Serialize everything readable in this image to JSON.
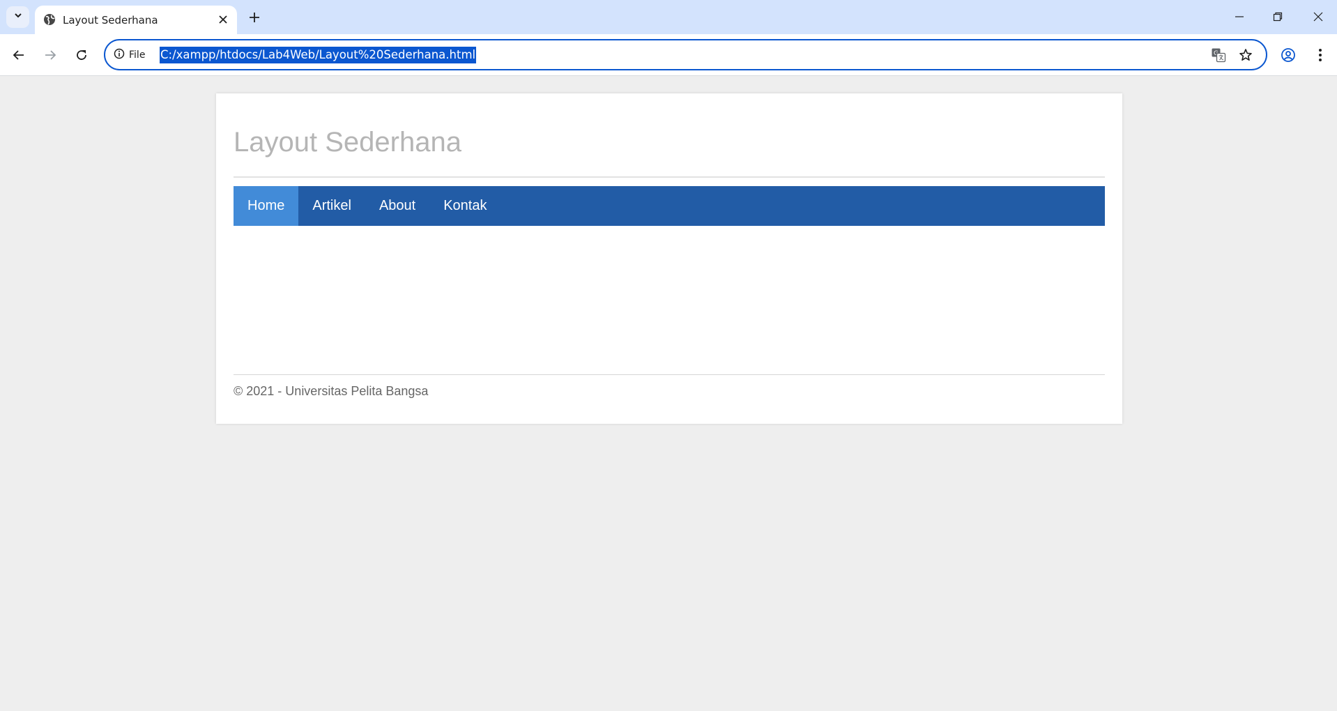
{
  "browser": {
    "tab": {
      "title": "Layout Sederhana"
    },
    "address_bar": {
      "scheme_label": "File",
      "url": "C:/xampp/htdocs/Lab4Web/Layout%20Sederhana.html"
    },
    "accent_color": "#0b57d0",
    "tabstrip_color": "#d3e3fd",
    "icons": [
      "tab-search-icon",
      "globe-icon",
      "close-icon",
      "plus-icon",
      "minimize-icon",
      "restore-icon",
      "close-window-icon",
      "back-arrow-icon",
      "forward-arrow-icon",
      "reload-icon",
      "info-icon",
      "translate-icon",
      "star-icon",
      "profile-icon",
      "more-vert-icon"
    ]
  },
  "page": {
    "title": "Layout Sederhana",
    "nav": {
      "items": [
        {
          "label": "Home",
          "active": true
        },
        {
          "label": "Artikel",
          "active": false
        },
        {
          "label": "About",
          "active": false
        },
        {
          "label": "Kontak",
          "active": false
        }
      ]
    },
    "footer": {
      "text": "© 2021 - Universitas Pelita Bangsa"
    },
    "colors": {
      "nav_background": "#225ca6",
      "nav_active": "#428bd8",
      "title_color": "#b5b5b5",
      "page_background": "#eeeeee"
    }
  }
}
